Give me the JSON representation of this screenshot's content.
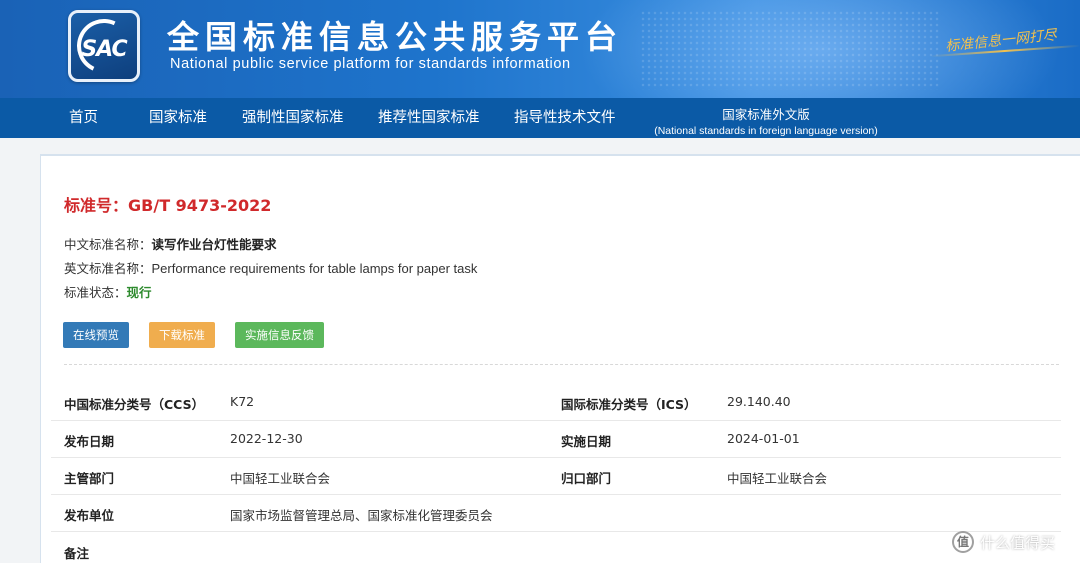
{
  "header": {
    "logo_text": "SAC",
    "title": "全国标准信息公共服务平台",
    "subtitle": "National public service platform  for standards information",
    "slogan": "标准信息一网打尽"
  },
  "nav": {
    "items": [
      {
        "label": "首页"
      },
      {
        "label": "国家标准"
      },
      {
        "label": "强制性国家标准"
      },
      {
        "label": "推荐性国家标准"
      },
      {
        "label": "指导性技术文件"
      }
    ],
    "foreign": {
      "label": "国家标准外文版",
      "sub": "(National standards in foreign language version)"
    }
  },
  "standard": {
    "number_label": "标准号：",
    "number": "GB/T 9473-2022",
    "cn_name_label": "中文标准名称：",
    "cn_name": "读写作业台灯性能要求",
    "en_name_label": "英文标准名称：",
    "en_name": "Performance requirements for table lamps for paper task",
    "status_label": "标准状态：",
    "status": "现行"
  },
  "buttons": {
    "preview": "在线预览",
    "download": "下载标准",
    "feedback": "实施信息反馈"
  },
  "details": {
    "ccs_label": "中国标准分类号（CCS）",
    "ccs": "K72",
    "ics_label": "国际标准分类号（ICS）",
    "ics": "29.140.40",
    "publish_date_label": "发布日期",
    "publish_date": "2022-12-30",
    "impl_date_label": "实施日期",
    "impl_date": "2024-01-01",
    "dept_label": "主管部门",
    "dept": "中国轻工业联合会",
    "owner_label": "归口部门",
    "owner": "中国轻工业联合会",
    "issuer_label": "发布单位",
    "issuer": "国家市场监督管理总局、国家标准化管理委员会",
    "remark_label": "备注"
  },
  "watermark": {
    "icon": "值",
    "text": "什么值得买"
  },
  "colors": {
    "banner": "#1e74cc",
    "nav": "#0b5aa6",
    "standard_number": "#d0292b",
    "status": "#2e8b2e",
    "btn_blue": "#337ab7",
    "btn_orange": "#f0ad4e",
    "btn_green": "#5cb85c"
  }
}
